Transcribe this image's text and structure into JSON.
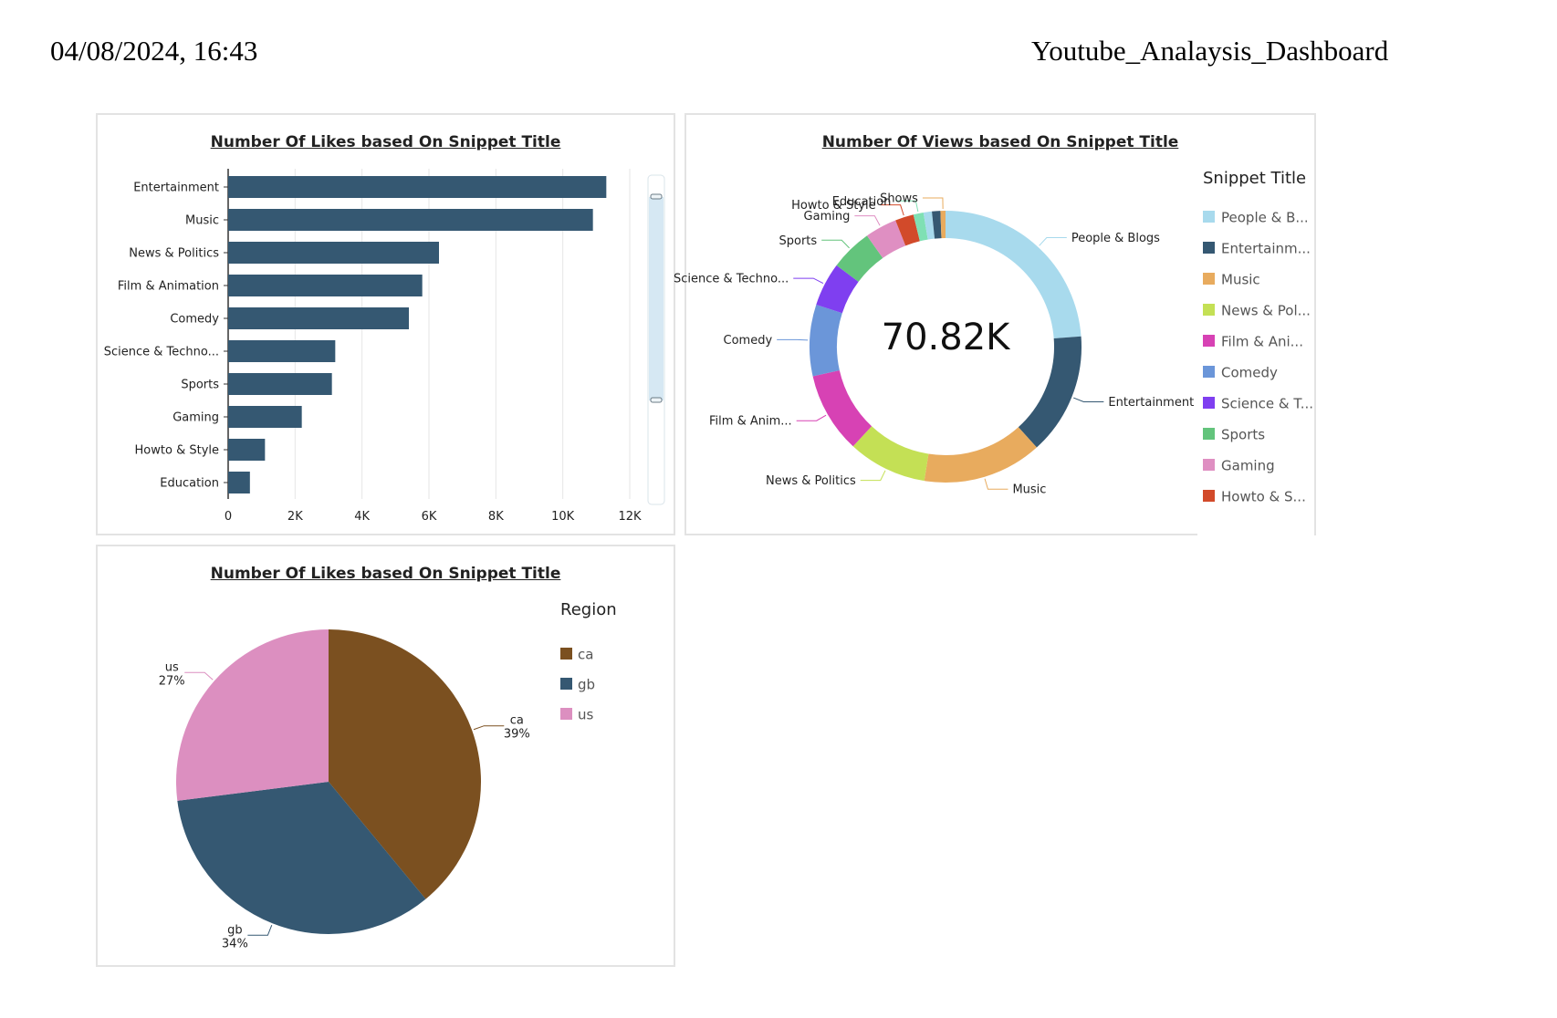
{
  "header": {
    "datetime": "04/08/2024, 16:43",
    "title": "Youtube_Analaysis_Dashboard"
  },
  "colors": {
    "bar": "#355872",
    "card_border": "#e3e3e3",
    "scroll_track": "#d6e8f3"
  },
  "charts": {
    "bar": {
      "title": "Number Of Likes based On Snippet Title",
      "tick_labels": [
        "0",
        "2K",
        "4K",
        "6K",
        "8K",
        "10K",
        "12K"
      ]
    },
    "donut": {
      "title": "Number Of Views based On Snippet Title",
      "center_value": "70.82K",
      "legend_title": "Snippet Title",
      "legend_items": [
        "People & B...",
        "Entertainm...",
        "Music",
        "News & Pol...",
        "Film & Ani...",
        "Comedy",
        "Science & T...",
        "Sports",
        "Gaming",
        "Howto & S...",
        "Educatio..."
      ]
    },
    "pie": {
      "title": "Number Of Likes based On Snippet Title",
      "legend_title": "Region"
    }
  },
  "chart_data": [
    {
      "type": "bar",
      "orientation": "horizontal",
      "title": "Number Of Likes based On Snippet Title",
      "categories": [
        "Entertainment",
        "Music",
        "News & Politics",
        "Film & Animation",
        "Comedy",
        "Science & Techno...",
        "Sports",
        "Gaming",
        "Howto & Style",
        "Education"
      ],
      "values": [
        11300,
        10900,
        6300,
        5800,
        5400,
        3200,
        3100,
        2200,
        1100,
        650
      ],
      "xlim": [
        0,
        12000
      ],
      "xticks": [
        0,
        2000,
        4000,
        6000,
        8000,
        10000,
        12000
      ],
      "grid": true,
      "color": "#355872"
    },
    {
      "type": "pie",
      "donut": true,
      "title": "Number Of Views based On Snippet Title",
      "center_label": "70.82K",
      "legend_title": "Snippet Title",
      "legend_position": "right",
      "slices": [
        {
          "label": "People & Blogs",
          "value": 23.8,
          "color": "#a8daed"
        },
        {
          "label": "Entertainment",
          "value": 14.5,
          "color": "#355872"
        },
        {
          "label": "Music",
          "value": 14.2,
          "color": "#e8ab5e"
        },
        {
          "label": "News & Politics",
          "value": 9.4,
          "color": "#c4e055"
        },
        {
          "label": "Film & Anim...",
          "value": 9.6,
          "color": "#d742b4"
        },
        {
          "label": "Comedy",
          "value": 8.5,
          "color": "#6b96d9"
        },
        {
          "label": "Science & Techno...",
          "value": 5.2,
          "color": "#7f3ff0"
        },
        {
          "label": "Sports",
          "value": 5.0,
          "color": "#63c47c"
        },
        {
          "label": "Gaming",
          "value": 3.8,
          "color": "#df8fc2"
        },
        {
          "label": "Howto & Style",
          "value": 2.2,
          "color": "#d24a2a"
        },
        {
          "label": "Education",
          "value": 1.2,
          "color": "#7fe0b4"
        },
        {
          "label": "",
          "value": 1.0,
          "color": "#a8daed"
        },
        {
          "label": "",
          "value": 1.0,
          "color": "#355872"
        },
        {
          "label": "Shows",
          "value": 0.6,
          "color": "#e8ab5e"
        }
      ]
    },
    {
      "type": "pie",
      "title": "Number Of Likes based On Snippet Title",
      "legend_title": "Region",
      "legend_position": "right",
      "slices": [
        {
          "label": "ca",
          "value": 39,
          "pct_label": "39%",
          "color": "#7b5020"
        },
        {
          "label": "gb",
          "value": 34,
          "pct_label": "34%",
          "color": "#355872"
        },
        {
          "label": "us",
          "value": 27,
          "pct_label": "27%",
          "color": "#dc8fc0"
        }
      ]
    }
  ]
}
